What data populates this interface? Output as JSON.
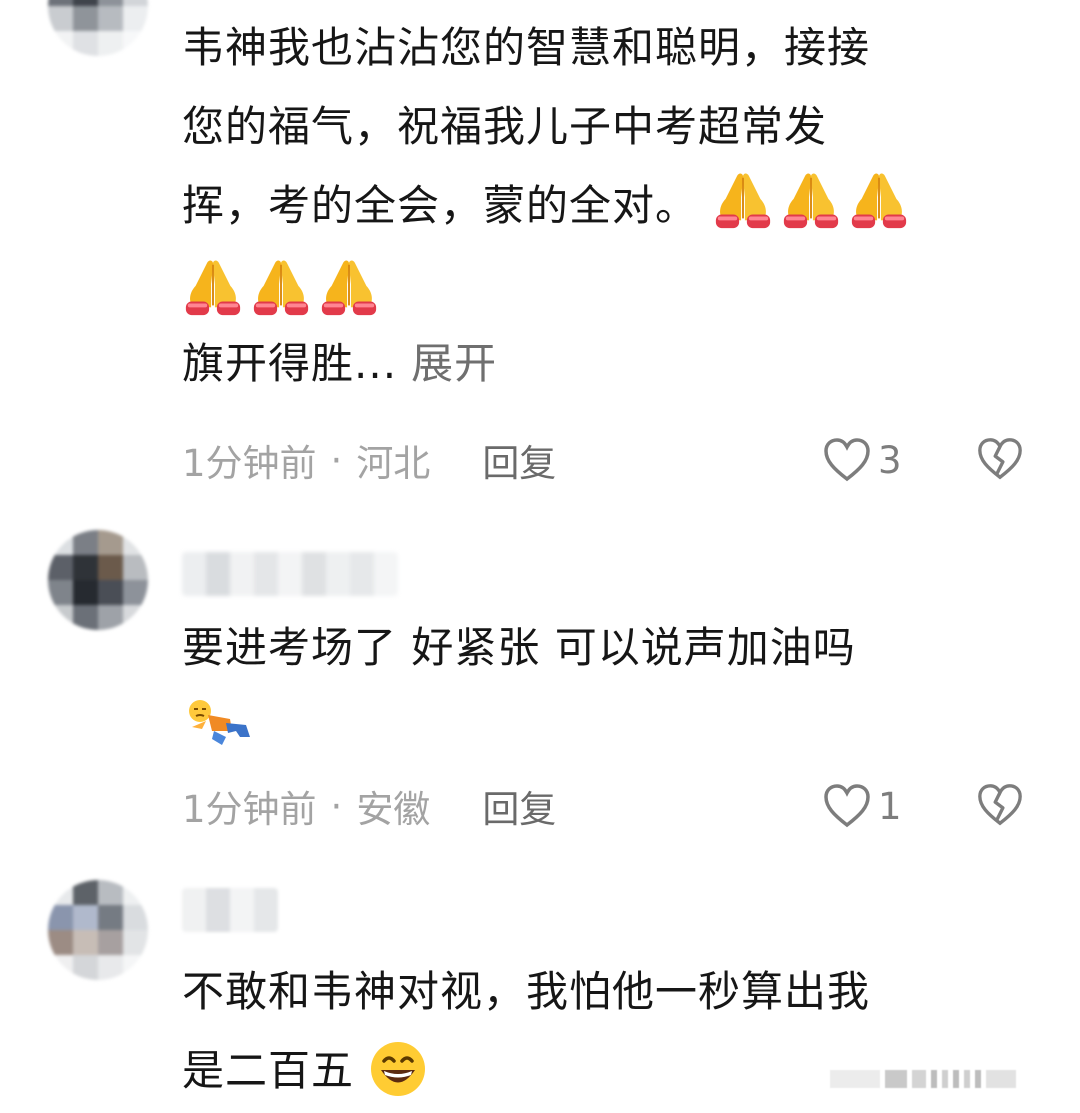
{
  "comments": [
    {
      "text_lines": [
        "韦神我也沾沾您的智慧和聪明，接接",
        "您的福气，祝福我儿子中考超常发",
        "挥，考的全会，蒙的全对。"
      ],
      "inline_emoji": [
        "folded-hands",
        "folded-hands",
        "folded-hands"
      ],
      "emoji_line": [
        "folded-hands",
        "folded-hands",
        "folded-hands"
      ],
      "tail_text": "旗开得胜...",
      "expand_label": "展开",
      "time": "1分钟前",
      "separator": "·",
      "location": "河北",
      "reply_label": "回复",
      "like_count": "3"
    },
    {
      "text_lines": [
        "要进考场了 好紧张 可以说声加油吗"
      ],
      "emoji_line": [
        "lying-figure"
      ],
      "time": "1分钟前",
      "separator": "·",
      "location": "安徽",
      "reply_label": "回复",
      "like_count": "1"
    },
    {
      "text_lines": [
        "不敢和韦神对视，我怕他一秒算出我",
        "是二百五"
      ],
      "inline_emoji": [
        "grinning-face"
      ]
    }
  ],
  "icons": {
    "like": "heart-outline-icon",
    "dislike": "broken-heart-icon"
  },
  "colors": {
    "text": "#161616",
    "meta": "#a3a3a3",
    "reply": "#6a6a6a",
    "expand": "#6f6f6f"
  }
}
